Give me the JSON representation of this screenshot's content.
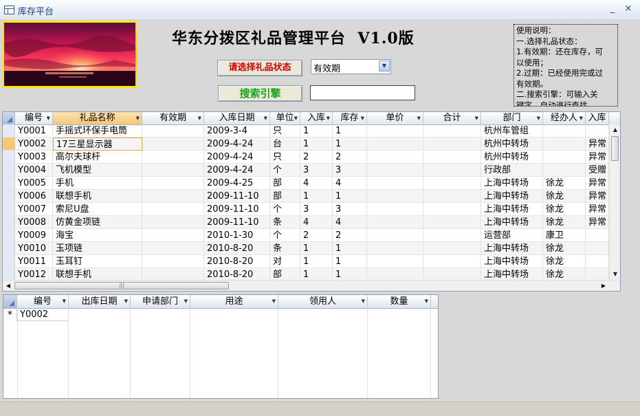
{
  "window": {
    "title": "库存平台",
    "minimize": "_",
    "close": "×"
  },
  "app": {
    "title": "华东分拨区礼品管理平台  V1.0版"
  },
  "controls": {
    "status_button": "请选择礼品状态",
    "status_select": "有效期",
    "search_button": "搜索引擎",
    "search_value": ""
  },
  "help": {
    "lines": [
      "使用说明：",
      "一.选择礼品状态：",
      "1.有效期：还在库存，可",
      "以使用；",
      "2.过期：已经使用完或过",
      "有效期。",
      "二.搜索引擎：可输入关",
      "键字，自动进行查找。"
    ]
  },
  "main_grid": {
    "columns": [
      "编号",
      "礼品名称",
      "有效期",
      "入库日期",
      "单位",
      "入库",
      "库存",
      "单价",
      "合计",
      "部门",
      "经办人",
      "入库"
    ],
    "rows": [
      [
        "Y0001",
        "手摇式环保手电筒",
        "",
        "2009-3-4",
        "只",
        "1",
        "1",
        "",
        "",
        "杭州车管组",
        "",
        ""
      ],
      [
        "Y0002",
        "17三星显示器",
        "",
        "2009-4-24",
        "台",
        "1",
        "1",
        "",
        "",
        "杭州中转场",
        "",
        "异常"
      ],
      [
        "Y0003",
        "高尔夫球杆",
        "",
        "2009-4-24",
        "只",
        "2",
        "2",
        "",
        "",
        "杭州中转场",
        "",
        "异常"
      ],
      [
        "Y0004",
        "飞机模型",
        "",
        "2009-4-24",
        "个",
        "3",
        "3",
        "",
        "",
        "行政部",
        "",
        "受赠"
      ],
      [
        "Y0005",
        "手机",
        "",
        "2009-4-25",
        "部",
        "4",
        "4",
        "",
        "",
        "上海中转场",
        "徐龙",
        "异常"
      ],
      [
        "Y0006",
        "联想手机",
        "",
        "2009-11-10",
        "部",
        "1",
        "1",
        "",
        "",
        "上海中转场",
        "徐龙",
        "异常"
      ],
      [
        "Y0007",
        "索尼U盘",
        "",
        "2009-11-10",
        "个",
        "3",
        "3",
        "",
        "",
        "上海中转场",
        "徐龙",
        "异常"
      ],
      [
        "Y0008",
        "仿黄金项链",
        "",
        "2009-11-10",
        "条",
        "4",
        "4",
        "",
        "",
        "上海中转场",
        "徐龙",
        "异常"
      ],
      [
        "Y0009",
        "海宝",
        "",
        "2010-1-30",
        "个",
        "2",
        "2",
        "",
        "",
        "运营部",
        "康卫",
        ""
      ],
      [
        "Y0010",
        "玉项链",
        "",
        "2010-8-20",
        "条",
        "1",
        "1",
        "",
        "",
        "上海中转场",
        "徐龙",
        ""
      ],
      [
        "Y0011",
        "玉耳钉",
        "",
        "2010-8-20",
        "对",
        "1",
        "1",
        "",
        "",
        "上海中转场",
        "徐龙",
        ""
      ],
      [
        "Y0012",
        "联想手机",
        "",
        "2010-8-20",
        "部",
        "1",
        "1",
        "",
        "",
        "上海中转场",
        "徐龙",
        ""
      ]
    ]
  },
  "sub_grid": {
    "columns": [
      "编号",
      "出库日期",
      "申请部门",
      "用途",
      "领用人",
      "数量"
    ],
    "new_row_marker": "*",
    "rows": [
      [
        "Y0002",
        "",
        "",
        "",
        "",
        ""
      ]
    ]
  }
}
